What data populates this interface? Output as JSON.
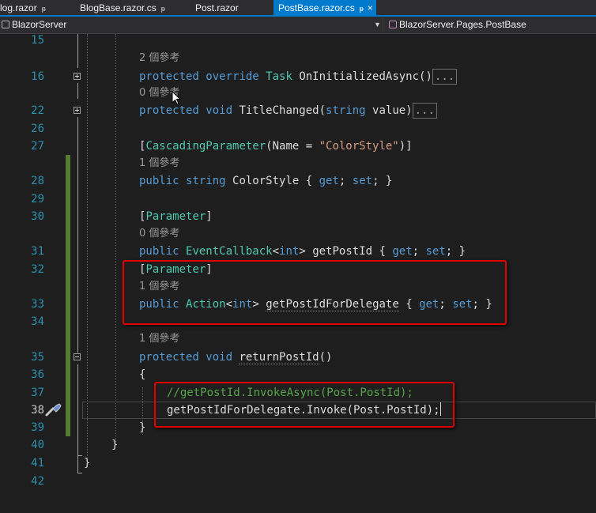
{
  "tabs": [
    {
      "label": "log.razor",
      "pinned": true
    },
    {
      "label": "BlogBase.razor.cs",
      "pinned": true
    },
    {
      "label": "Post.razor",
      "pinned": false
    },
    {
      "label": "PostBase.razor.cs",
      "active": true,
      "pinned": true,
      "close": "×"
    }
  ],
  "pin_glyph": "ᵽ",
  "navbar": {
    "project": "BlazorServer",
    "member": "BlazorServer.Pages.PostBase"
  },
  "references": {
    "r2": "2 個參考",
    "r0a": "0 個參考",
    "r1a": "1 個參考",
    "r0b": "0 個參考",
    "r1b": "1 個參考",
    "r1c": "1 個參考"
  },
  "line_numbers": [
    "15",
    "16",
    "22",
    "26",
    "27",
    "28",
    "29",
    "30",
    "31",
    "32",
    "33",
    "34",
    "35",
    "36",
    "37",
    "38",
    "39",
    "40",
    "41",
    "42"
  ],
  "code": {
    "l16": {
      "k1": "protected",
      "k2": "override",
      "t": "Task",
      "name": " OnInitializedAsync()",
      "collapsed": "..."
    },
    "l22": {
      "k1": "protected",
      "k2": "void",
      "name": " TitleChanged(",
      "k3": "string",
      "rest": " value)",
      "collapsed": "..."
    },
    "l27": {
      "open": "[",
      "attr": "CascadingParameter",
      "mid": "(Name = ",
      "str": "\"ColorStyle\"",
      "close": ")]"
    },
    "l28": {
      "k1": "public",
      "k2": "string",
      "name": " ColorStyle { ",
      "get": "get",
      "sep": "; ",
      "set": "set",
      "end": "; }"
    },
    "l30": {
      "open": "[",
      "attr": "Parameter",
      "close": "]"
    },
    "l31": {
      "k1": "public",
      "t": "EventCallback",
      "lt": "<",
      "k2": "int",
      "gt": ">",
      "name": " getPostId { ",
      "get": "get",
      "sep": "; ",
      "set": "set",
      "end": "; }"
    },
    "l32": {
      "open": "[",
      "attr": "Parameter",
      "close": "]"
    },
    "l33": {
      "k1": "public",
      "t": "Action",
      "lt": "<",
      "k2": "int",
      "gt": ">",
      "name": "getPostIdForDelegate",
      "mid": " { ",
      "get": "get",
      "sep": "; ",
      "set": "set",
      "end": "; }"
    },
    "l35": {
      "k1": "protected",
      "k2": "void",
      "name": "returnPostId",
      "rest": "()"
    },
    "l36": "{",
    "l37": "//getPostId.InvokeAsync(Post.PostId);",
    "l38": "getPostIdForDelegate.Invoke(Post.PostId);",
    "l39": "}",
    "l40": "}",
    "l41": "}"
  },
  "colors": {
    "keyword": "#569cd6",
    "type": "#4ec9b0",
    "string": "#d69d85",
    "comment": "#57a64a",
    "line_number": "#2b91af",
    "highlight_box": "#e00000",
    "tab_active": "#007acc",
    "change_bar": "#577b31"
  },
  "icons": {
    "close": "close-icon",
    "pin": "pin-icon",
    "dropdown": "chevron-down-icon",
    "quick_actions": "screwdriver-icon"
  }
}
